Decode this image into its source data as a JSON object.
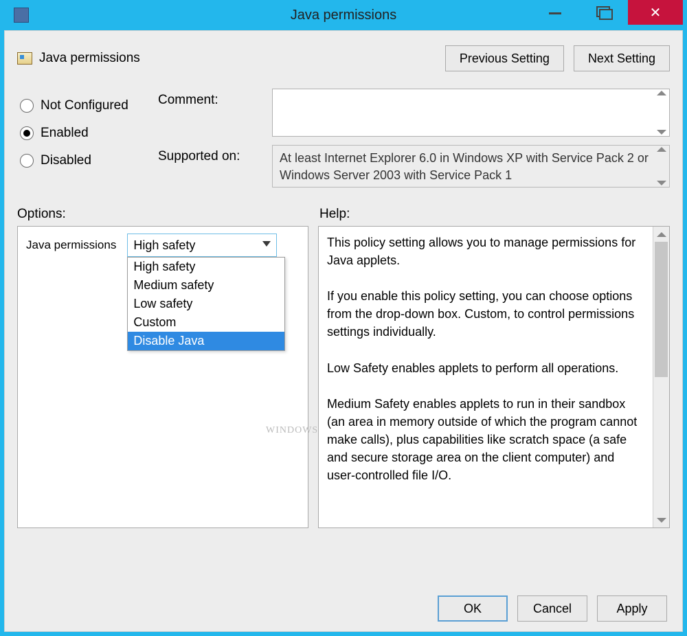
{
  "titlebar": {
    "title": "Java permissions"
  },
  "policy_name": "Java permissions",
  "nav": {
    "prev": "Previous Setting",
    "next": "Next Setting"
  },
  "state": {
    "options": [
      {
        "label": "Not Configured",
        "checked": false
      },
      {
        "label": "Enabled",
        "checked": true
      },
      {
        "label": "Disabled",
        "checked": false
      }
    ]
  },
  "form": {
    "comment_label": "Comment:",
    "comment_value": "",
    "supported_label": "Supported on:",
    "supported_text": "At least Internet Explorer 6.0 in Windows XP with Service Pack 2 or Windows Server 2003 with Service Pack 1"
  },
  "section": {
    "options": "Options:",
    "help": "Help:"
  },
  "dropdown": {
    "label": "Java permissions",
    "value": "High safety",
    "items": [
      "High safety",
      "Medium safety",
      "Low safety",
      "Custom",
      "Disable Java"
    ],
    "highlighted": "Disable Java"
  },
  "help_text": "This policy setting allows you to manage permissions for Java applets.\n\nIf you enable this policy setting, you can choose options from the drop-down box. Custom, to control permissions settings individually.\n\nLow Safety enables applets to perform all operations.\n\nMedium Safety enables applets to run in their sandbox (an area in memory outside of which the program cannot make calls), plus capabilities like scratch space (a safe and secure storage area on the client computer) and user-controlled file I/O.",
  "buttons": {
    "ok": "OK",
    "cancel": "Cancel",
    "apply": "Apply"
  },
  "watermark": "WINDOWS"
}
